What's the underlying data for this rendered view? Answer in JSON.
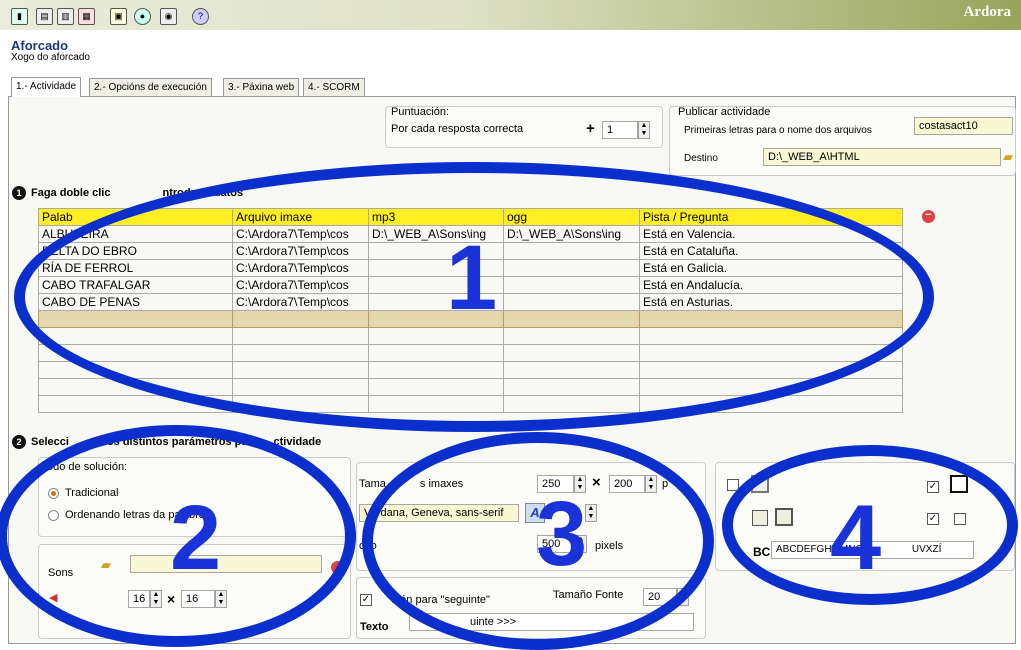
{
  "toolbar": {
    "icons": [
      "chart-icon",
      "document-icon",
      "copy-icon",
      "export-icon",
      "preview-icon",
      "web-icon",
      "eye-icon",
      "help-icon"
    ]
  },
  "app": {
    "brand": "Ardora"
  },
  "header": {
    "title": "Aforcado",
    "subtitle": "Xogo do aforcado"
  },
  "tabs": [
    "1.- Actividade",
    "2.- Opcións de execución",
    "3.- Páxina web",
    "4.- SCORM"
  ],
  "puntuacion": {
    "legend": "Puntuación:",
    "label": "Por cada resposta correcta",
    "plus": "+",
    "value": "1"
  },
  "publicar": {
    "legend": "Publicar actividade",
    "prefix_label": "Primeiras letras para o nome dos arquivos",
    "prefix_value": "costasact10",
    "destino_label": "Destino",
    "destino_value": "D:\\_WEB_A\\HTML"
  },
  "section1": {
    "number": "1",
    "title": "Faga doble clic",
    "title_end": "ntroducir datos"
  },
  "table": {
    "headers": [
      "Palab",
      "Arquivo imaxe",
      "mp3",
      "ogg",
      "Pista / Pregunta"
    ],
    "rows": [
      [
        "ALBUFEIRA",
        "C:\\Ardora7\\Temp\\cos",
        "D:\\_WEB_A\\Sons\\ing",
        "D:\\_WEB_A\\Sons\\ing",
        "Está en Valencia."
      ],
      [
        "DELTA DO EBRO",
        "C:\\Ardora7\\Temp\\cos",
        "",
        "",
        "Está en Cataluña."
      ],
      [
        "RÍA DE FERROL",
        "C:\\Ardora7\\Temp\\cos",
        "",
        "",
        "Está en Galicia."
      ],
      [
        "CABO TRAFALGAR",
        "C:\\Ardora7\\Temp\\cos",
        "",
        "",
        "Está en Andalucía."
      ],
      [
        "CABO DE PENAS",
        "C:\\Ardora7\\Temp\\cos",
        "",
        "",
        "Está en Asturias."
      ]
    ]
  },
  "section2": {
    "number": "2",
    "title_start": "Selecci",
    "title_end": "os distintos parámetros pa",
    "title_tail": "ctividade"
  },
  "solucion": {
    "legend": "odo de solución:",
    "options": [
      "Tradicional",
      "Ordenando letras da palabra"
    ],
    "selected": "Tradicional"
  },
  "sons": {
    "label": "Sons",
    "w": "16",
    "x": "×",
    "h": "16"
  },
  "imaxes": {
    "label": "Tama",
    "label_end": "s imaxes",
    "w": "250",
    "x": "×",
    "h": "200",
    "unit": "p",
    "font_value": "Verdana, Geneva, sans-serif",
    "ancho_label": "cho",
    "ancho_value": "500",
    "ancho_unit": "pixels"
  },
  "seguinte": {
    "checkbox_label": "otón para \"seguinte\"",
    "tam_label": "Tamaño Fonte",
    "tam_value": "20",
    "texto_label": "Texto",
    "texto_value": "uinte >>>"
  },
  "chars": {
    "abc_prefix": "BC",
    "abc_value": "ABCDEFGHILMNOP",
    "abc_tail": "UVXZÍ"
  },
  "overlays": {
    "numbers": [
      "1",
      "2",
      "3",
      "4"
    ],
    "color": "#0a2fcc"
  }
}
